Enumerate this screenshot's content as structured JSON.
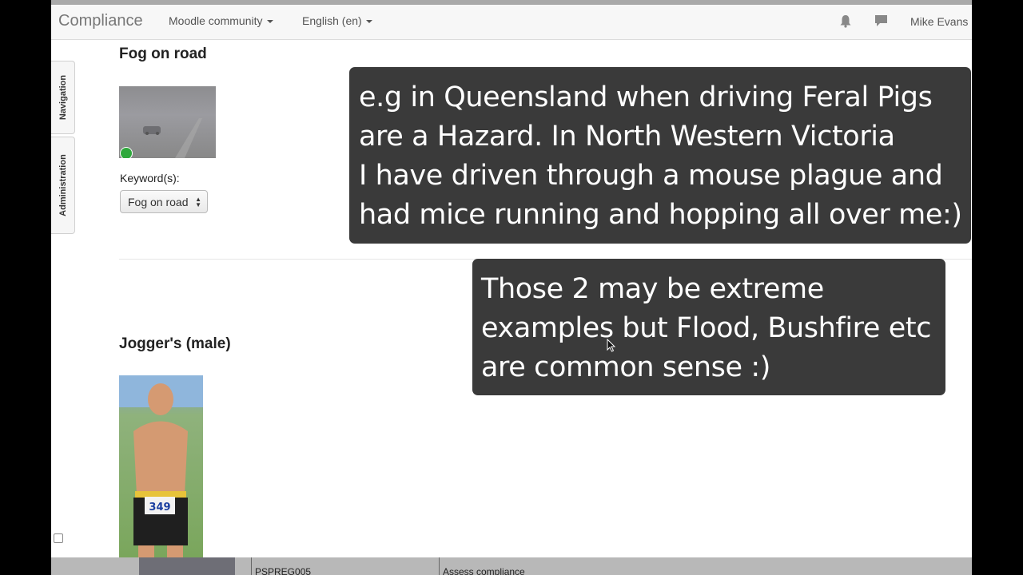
{
  "navbar": {
    "brand": "Compliance",
    "menus": [
      "Moodle community",
      "English (en)"
    ],
    "icons": [
      "bell-icon",
      "chat-icon"
    ],
    "user": "Mike Evans"
  },
  "side_tabs": [
    "Navigation",
    "Administration"
  ],
  "items": [
    {
      "heading": "Fog on road",
      "keyword_label": "Keyword(s):",
      "keyword_value": "Fog on road"
    },
    {
      "heading": "Jogger's (male)"
    }
  ],
  "overlays": [
    "e.g in Queensland when driving Feral Pigs\nare a Hazard. In North Western Victoria\nI have driven through a mouse plague and\nhad mice running and hopping all over me:)",
    "Those 2 may be extreme\nexamples but Flood, Bushfire etc\nare common sense :)"
  ],
  "bottom_table": {
    "code": "PSPREG005",
    "title": "Assess compliance"
  },
  "jogger_bib": "349",
  "colors": {
    "overlay_bg": "#3a3a3a",
    "navbar_bg": "#f7f7f7",
    "frame_bg": "#000000"
  }
}
